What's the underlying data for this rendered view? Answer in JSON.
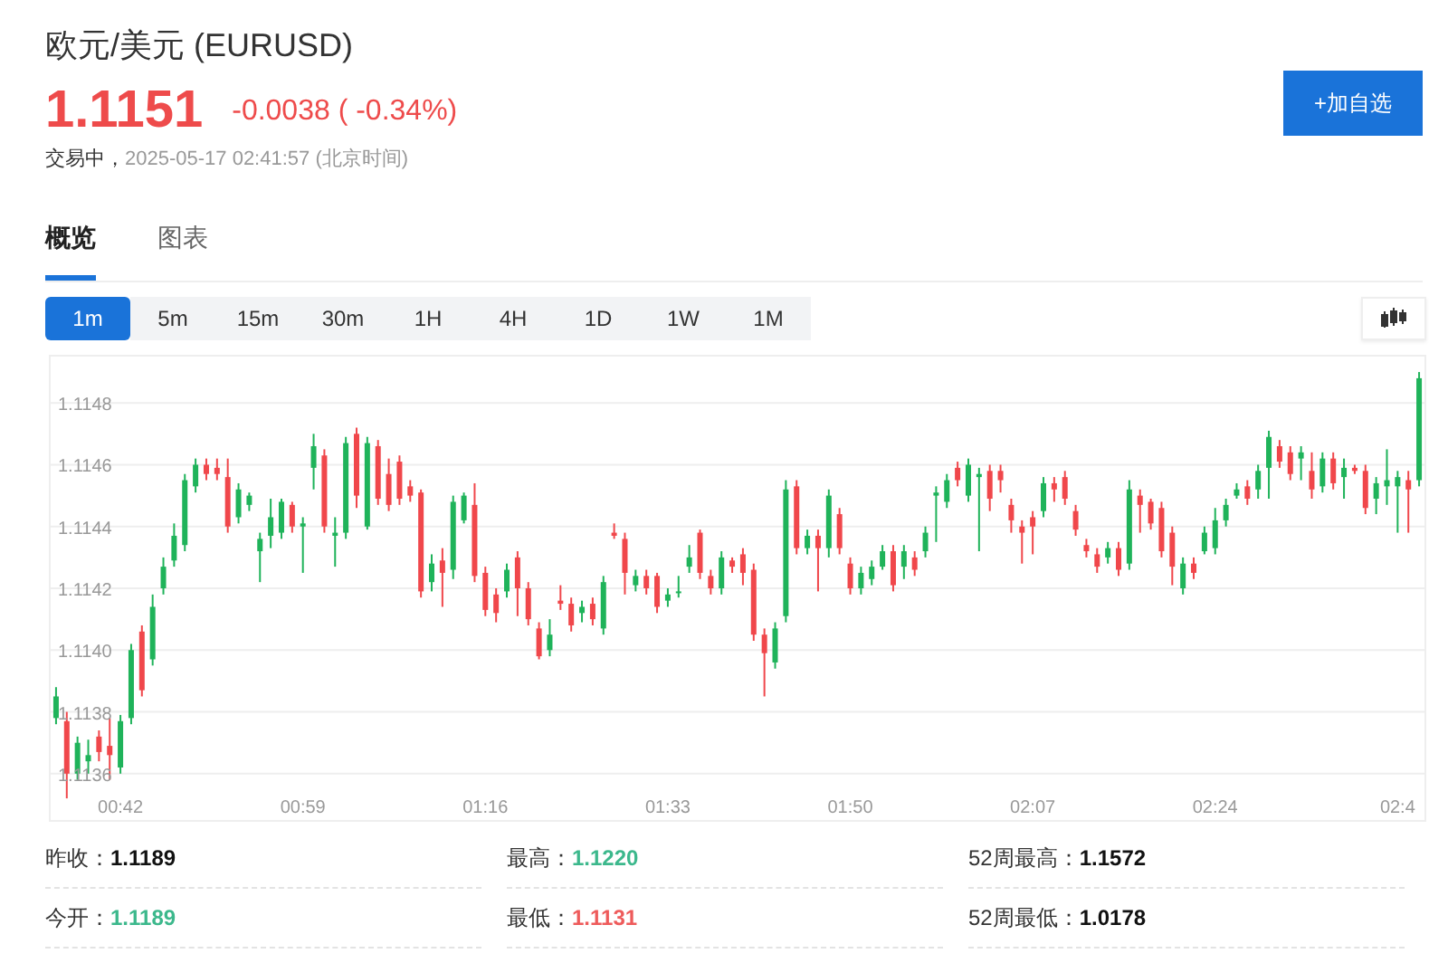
{
  "header": {
    "title": "欧元/美元",
    "symbol": "(EURUSD)",
    "price": "1.1151",
    "change": "-0.0038",
    "change_percent": "( -0.34%)",
    "status": "交易中，",
    "time": "2025-05-17 02:41:57",
    "timezone": "(北京时间)",
    "add_button": "+加自选"
  },
  "tabs": [
    {
      "label": "概览",
      "selected": true
    },
    {
      "label": "图表",
      "selected": false
    }
  ],
  "periods": [
    {
      "label": "1m",
      "selected": true
    },
    {
      "label": "5m",
      "selected": false
    },
    {
      "label": "15m",
      "selected": false
    },
    {
      "label": "30m",
      "selected": false
    },
    {
      "label": "1H",
      "selected": false
    },
    {
      "label": "4H",
      "selected": false
    },
    {
      "label": "1D",
      "selected": false
    },
    {
      "label": "1W",
      "selected": false
    },
    {
      "label": "1M",
      "selected": false
    }
  ],
  "chart": {
    "chart_data": {
      "type": "candlestick",
      "grid": true,
      "ylim": [
        1.11345,
        1.11495
      ],
      "yticks": [
        {
          "value": 1.1148,
          "label": "1.1148"
        },
        {
          "value": 1.1146,
          "label": "1.1146"
        },
        {
          "value": 1.1144,
          "label": "1.1144"
        },
        {
          "value": 1.1142,
          "label": "1.1142"
        },
        {
          "value": 1.114,
          "label": "1.1140"
        },
        {
          "value": 1.1138,
          "label": "1.1138"
        },
        {
          "value": 1.1136,
          "label": "1.1136"
        }
      ],
      "categories": [
        null,
        null,
        null,
        null,
        null,
        null,
        "00:42",
        null,
        null,
        null,
        null,
        null,
        null,
        null,
        null,
        null,
        null,
        null,
        null,
        null,
        null,
        null,
        null,
        "00:59",
        null,
        null,
        null,
        null,
        null,
        null,
        null,
        null,
        null,
        null,
        null,
        null,
        null,
        null,
        null,
        null,
        "01:16",
        null,
        null,
        null,
        null,
        null,
        null,
        null,
        null,
        null,
        null,
        null,
        null,
        null,
        null,
        null,
        null,
        "01:33",
        null,
        null,
        null,
        null,
        null,
        null,
        null,
        null,
        null,
        null,
        null,
        null,
        null,
        null,
        null,
        null,
        "01:50",
        null,
        null,
        null,
        null,
        null,
        null,
        null,
        null,
        null,
        null,
        null,
        null,
        null,
        null,
        null,
        null,
        "02:07",
        null,
        null,
        null,
        null,
        null,
        null,
        null,
        null,
        null,
        null,
        null,
        null,
        null,
        null,
        null,
        null,
        "02:24",
        null,
        null,
        null,
        null,
        null,
        null,
        null,
        null,
        null,
        null,
        null,
        null,
        null,
        null,
        null,
        null,
        "02:4",
        null,
        null
      ],
      "ohlc": [
        [
          1.11378,
          1.11388,
          1.11376,
          1.11385
        ],
        [
          1.11377,
          1.1138,
          1.11352,
          1.1136
        ],
        [
          1.1136,
          1.11372,
          1.11358,
          1.1137
        ],
        [
          1.11364,
          1.11371,
          1.1136,
          1.11366
        ],
        [
          1.11372,
          1.11374,
          1.11364,
          1.11367
        ],
        [
          1.11369,
          1.11378,
          1.11358,
          1.11366
        ],
        [
          1.11362,
          1.11379,
          1.1136,
          1.11377
        ],
        [
          1.11378,
          1.11402,
          1.11376,
          1.114
        ],
        [
          1.11406,
          1.11408,
          1.11385,
          1.11387
        ],
        [
          1.11397,
          1.11418,
          1.11395,
          1.11414
        ],
        [
          1.1142,
          1.1143,
          1.11418,
          1.11427
        ],
        [
          1.11429,
          1.11441,
          1.11427,
          1.11437
        ],
        [
          1.11434,
          1.11457,
          1.11432,
          1.11455
        ],
        [
          1.11453,
          1.11462,
          1.11451,
          1.1146
        ],
        [
          1.1146,
          1.11462,
          1.11455,
          1.11457
        ],
        [
          1.11459,
          1.11462,
          1.11455,
          1.11457
        ],
        [
          1.11456,
          1.11462,
          1.11438,
          1.1144
        ],
        [
          1.11443,
          1.11454,
          1.11441,
          1.11452
        ],
        [
          1.11447,
          1.11451,
          1.11445,
          1.1145
        ],
        [
          1.11432,
          1.11438,
          1.11422,
          1.11436
        ],
        [
          1.11437,
          1.11449,
          1.11433,
          1.11443
        ],
        [
          1.11438,
          1.11449,
          1.11436,
          1.11448
        ],
        [
          1.11447,
          1.11448,
          1.11438,
          1.1144
        ],
        [
          1.1144,
          1.11443,
          1.11425,
          1.11441
        ],
        [
          1.11459,
          1.1147,
          1.11452,
          1.11466
        ],
        [
          1.11463,
          1.11465,
          1.11438,
          1.1144
        ],
        [
          1.11437,
          1.11443,
          1.11427,
          1.11438
        ],
        [
          1.11438,
          1.11469,
          1.11436,
          1.11467
        ],
        [
          1.1147,
          1.11472,
          1.11446,
          1.1145
        ],
        [
          1.1144,
          1.11469,
          1.11439,
          1.11467
        ],
        [
          1.11466,
          1.11468,
          1.11447,
          1.11449
        ],
        [
          1.11457,
          1.11462,
          1.11445,
          1.11447
        ],
        [
          1.11461,
          1.11463,
          1.11447,
          1.11449
        ],
        [
          1.11453,
          1.11455,
          1.11448,
          1.1145
        ],
        [
          1.11451,
          1.11452,
          1.11417,
          1.11419
        ],
        [
          1.11422,
          1.11431,
          1.11419,
          1.11428
        ],
        [
          1.11429,
          1.11433,
          1.11414,
          1.11425
        ],
        [
          1.11426,
          1.1145,
          1.11423,
          1.11448
        ],
        [
          1.11442,
          1.11451,
          1.11441,
          1.1145
        ],
        [
          1.11447,
          1.11454,
          1.11422,
          1.11424
        ],
        [
          1.11425,
          1.11427,
          1.11411,
          1.11413
        ],
        [
          1.11418,
          1.1142,
          1.11409,
          1.11412
        ],
        [
          1.11419,
          1.11428,
          1.11417,
          1.11426
        ],
        [
          1.1143,
          1.11432,
          1.11411,
          1.1142
        ],
        [
          1.1142,
          1.11422,
          1.11408,
          1.1141
        ],
        [
          1.11407,
          1.11409,
          1.11397,
          1.11398
        ],
        [
          1.114,
          1.1141,
          1.11398,
          1.11405
        ],
        [
          1.11416,
          1.11421,
          1.11413,
          1.11415
        ],
        [
          1.11415,
          1.11417,
          1.11406,
          1.11408
        ],
        [
          1.11412,
          1.11416,
          1.11409,
          1.11414
        ],
        [
          1.11415,
          1.11417,
          1.11408,
          1.1141
        ],
        [
          1.11407,
          1.11424,
          1.11405,
          1.11422
        ],
        [
          1.11438,
          1.11441,
          1.11436,
          1.11437
        ],
        [
          1.11436,
          1.11438,
          1.11418,
          1.11425
        ],
        [
          1.11421,
          1.11426,
          1.11419,
          1.11424
        ],
        [
          1.11424,
          1.11426,
          1.11418,
          1.1142
        ],
        [
          1.11424,
          1.11425,
          1.11412,
          1.11414
        ],
        [
          1.11416,
          1.1142,
          1.11414,
          1.11418
        ],
        [
          1.11419,
          1.11424,
          1.11417,
          1.11419
        ],
        [
          1.11427,
          1.11434,
          1.11425,
          1.1143
        ],
        [
          1.11438,
          1.11439,
          1.11423,
          1.11425
        ],
        [
          1.11424,
          1.11426,
          1.11418,
          1.1142
        ],
        [
          1.1142,
          1.11432,
          1.11418,
          1.1143
        ],
        [
          1.11429,
          1.1143,
          1.11425,
          1.11427
        ],
        [
          1.11431,
          1.11433,
          1.11421,
          1.11425
        ],
        [
          1.11426,
          1.11428,
          1.11403,
          1.11405
        ],
        [
          1.11405,
          1.11407,
          1.11385,
          1.11399
        ],
        [
          1.11396,
          1.11409,
          1.11394,
          1.11407
        ],
        [
          1.11411,
          1.11455,
          1.11409,
          1.11452
        ],
        [
          1.11453,
          1.11455,
          1.11431,
          1.11433
        ],
        [
          1.11433,
          1.11439,
          1.11431,
          1.11437
        ],
        [
          1.11437,
          1.11439,
          1.11419,
          1.11433
        ],
        [
          1.11433,
          1.11452,
          1.1143,
          1.1145
        ],
        [
          1.11444,
          1.11446,
          1.11431,
          1.11433
        ],
        [
          1.11428,
          1.1143,
          1.11418,
          1.1142
        ],
        [
          1.1142,
          1.11427,
          1.11418,
          1.11425
        ],
        [
          1.11423,
          1.11429,
          1.11421,
          1.11427
        ],
        [
          1.11427,
          1.11434,
          1.11426,
          1.11432
        ],
        [
          1.11432,
          1.11434,
          1.11419,
          1.11421
        ],
        [
          1.11427,
          1.11434,
          1.11423,
          1.11432
        ],
        [
          1.1143,
          1.11432,
          1.11424,
          1.11426
        ],
        [
          1.11432,
          1.1144,
          1.1143,
          1.11438
        ],
        [
          1.1145,
          1.11453,
          1.11435,
          1.11451
        ],
        [
          1.11448,
          1.11457,
          1.11446,
          1.11455
        ],
        [
          1.11459,
          1.11461,
          1.11453,
          1.11455
        ],
        [
          1.1145,
          1.11462,
          1.11448,
          1.1146
        ],
        [
          1.11456,
          1.11459,
          1.11432,
          1.11457
        ],
        [
          1.11458,
          1.1146,
          1.11445,
          1.11449
        ],
        [
          1.11458,
          1.1146,
          1.11451,
          1.11455
        ],
        [
          1.11447,
          1.11449,
          1.11438,
          1.11442
        ],
        [
          1.1144,
          1.11442,
          1.11428,
          1.11438
        ],
        [
          1.11443,
          1.11445,
          1.11431,
          1.1144
        ],
        [
          1.11445,
          1.11456,
          1.11443,
          1.11454
        ],
        [
          1.11454,
          1.11456,
          1.11448,
          1.11452
        ],
        [
          1.11456,
          1.11458,
          1.11447,
          1.11449
        ],
        [
          1.11445,
          1.11447,
          1.11437,
          1.11439
        ],
        [
          1.11434,
          1.11436,
          1.1143,
          1.11432
        ],
        [
          1.11431,
          1.11433,
          1.11425,
          1.11427
        ],
        [
          1.1143,
          1.11435,
          1.11428,
          1.11433
        ],
        [
          1.11433,
          1.11435,
          1.11424,
          1.11426
        ],
        [
          1.11428,
          1.11455,
          1.11426,
          1.11452
        ],
        [
          1.1145,
          1.11452,
          1.11438,
          1.11447
        ],
        [
          1.11448,
          1.11449,
          1.11439,
          1.11441
        ],
        [
          1.11446,
          1.11448,
          1.1143,
          1.11432
        ],
        [
          1.11438,
          1.1144,
          1.11421,
          1.11427
        ],
        [
          1.1142,
          1.1143,
          1.11418,
          1.11428
        ],
        [
          1.11428,
          1.1143,
          1.11423,
          1.11425
        ],
        [
          1.11432,
          1.1144,
          1.11431,
          1.11438
        ],
        [
          1.11433,
          1.11446,
          1.11431,
          1.11442
        ],
        [
          1.11442,
          1.11449,
          1.1144,
          1.11447
        ],
        [
          1.1145,
          1.11454,
          1.11449,
          1.11452
        ],
        [
          1.11453,
          1.11455,
          1.11447,
          1.11449
        ],
        [
          1.11452,
          1.1146,
          1.11449,
          1.11458
        ],
        [
          1.11459,
          1.11471,
          1.11449,
          1.11469
        ],
        [
          1.11466,
          1.11468,
          1.11459,
          1.11461
        ],
        [
          1.11464,
          1.11466,
          1.11455,
          1.11457
        ],
        [
          1.11462,
          1.11466,
          1.11455,
          1.11464
        ],
        [
          1.11458,
          1.11464,
          1.11449,
          1.11452
        ],
        [
          1.11453,
          1.11464,
          1.11451,
          1.11462
        ],
        [
          1.11462,
          1.11464,
          1.11452,
          1.11454
        ],
        [
          1.11456,
          1.11462,
          1.11449,
          1.11459
        ],
        [
          1.11459,
          1.1146,
          1.11457,
          1.11458
        ],
        [
          1.11458,
          1.1146,
          1.11444,
          1.11446
        ],
        [
          1.11449,
          1.11456,
          1.11444,
          1.11454
        ],
        [
          1.11453,
          1.11465,
          1.11447,
          1.11455
        ],
        [
          1.11453,
          1.11458,
          1.11438,
          1.11456
        ],
        [
          1.11455,
          1.11458,
          1.11438,
          1.11452
        ],
        [
          1.11455,
          1.1149,
          1.11453,
          1.11488
        ]
      ]
    }
  },
  "stats": [
    {
      "label": "昨收：",
      "value": "1.1189",
      "color": "#111111"
    },
    {
      "label": "最高：",
      "value": "1.1220",
      "color": "#3cb88c"
    },
    {
      "label": "52周最高：",
      "value": "1.1572",
      "color": "#111111"
    },
    {
      "label": "今开：",
      "value": "1.1189",
      "color": "#3cb88c"
    },
    {
      "label": "最低：",
      "value": "1.1131",
      "color": "#ee5b5b"
    },
    {
      "label": "52周最低：",
      "value": "1.0178",
      "color": "#111111"
    }
  ]
}
